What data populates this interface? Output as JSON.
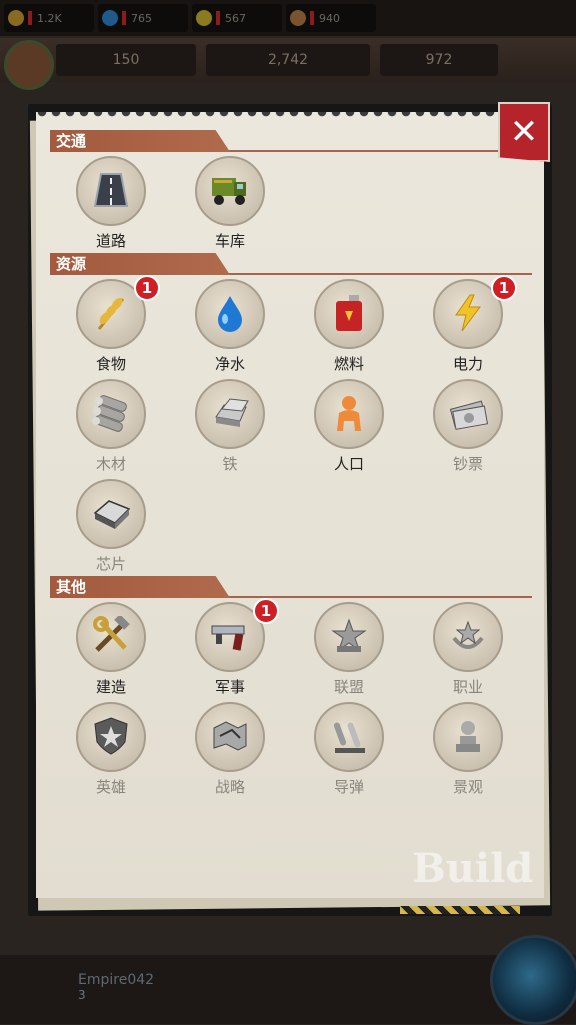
{
  "topbar": {
    "resources": [
      {
        "value": "1.2K",
        "icon": "wheat-icon"
      },
      {
        "value": "765",
        "icon": "water-icon"
      },
      {
        "value": "567",
        "icon": "lightning-icon"
      },
      {
        "value": "940",
        "icon": "log-icon"
      }
    ]
  },
  "hud": {
    "population": "150",
    "power": "2,742",
    "cash": "972"
  },
  "panel": {
    "close_icon": "close-icon",
    "sections": [
      {
        "title": "交通",
        "items": [
          {
            "label": "道路",
            "icon": "road-icon",
            "badge": null,
            "enabled": true
          },
          {
            "label": "车库",
            "icon": "truck-icon",
            "badge": null,
            "enabled": true
          }
        ]
      },
      {
        "title": "资源",
        "items": [
          {
            "label": "食物",
            "icon": "wheat-icon",
            "badge": "1",
            "enabled": true
          },
          {
            "label": "净水",
            "icon": "water-drop-icon",
            "badge": null,
            "enabled": true
          },
          {
            "label": "燃料",
            "icon": "fuel-can-icon",
            "badge": null,
            "enabled": true
          },
          {
            "label": "电力",
            "icon": "lightning-icon",
            "badge": "1",
            "enabled": true
          },
          {
            "label": "木材",
            "icon": "logs-icon",
            "badge": null,
            "enabled": false
          },
          {
            "label": "铁",
            "icon": "iron-ingot-icon",
            "badge": null,
            "enabled": false
          },
          {
            "label": "人口",
            "icon": "person-icon",
            "badge": null,
            "enabled": true
          },
          {
            "label": "钞票",
            "icon": "banknotes-icon",
            "badge": null,
            "enabled": false
          },
          {
            "label": "芯片",
            "icon": "chip-icon",
            "badge": null,
            "enabled": false
          }
        ]
      },
      {
        "title": "其他",
        "items": [
          {
            "label": "建造",
            "icon": "tools-icon",
            "badge": null,
            "enabled": true
          },
          {
            "label": "军事",
            "icon": "gun-icon",
            "badge": "1",
            "enabled": true
          },
          {
            "label": "联盟",
            "icon": "alliance-star-icon",
            "badge": null,
            "enabled": false
          },
          {
            "label": "职业",
            "icon": "profession-emblem-icon",
            "badge": null,
            "enabled": false
          },
          {
            "label": "英雄",
            "icon": "hero-badge-icon",
            "badge": null,
            "enabled": false
          },
          {
            "label": "战略",
            "icon": "strategy-map-icon",
            "badge": null,
            "enabled": false
          },
          {
            "label": "导弹",
            "icon": "missile-icon",
            "badge": null,
            "enabled": false
          },
          {
            "label": "景观",
            "icon": "monument-icon",
            "badge": null,
            "enabled": false
          }
        ]
      }
    ],
    "watermark": "Build"
  },
  "footer": {
    "player_name": "Empire042",
    "player_level": "3"
  }
}
